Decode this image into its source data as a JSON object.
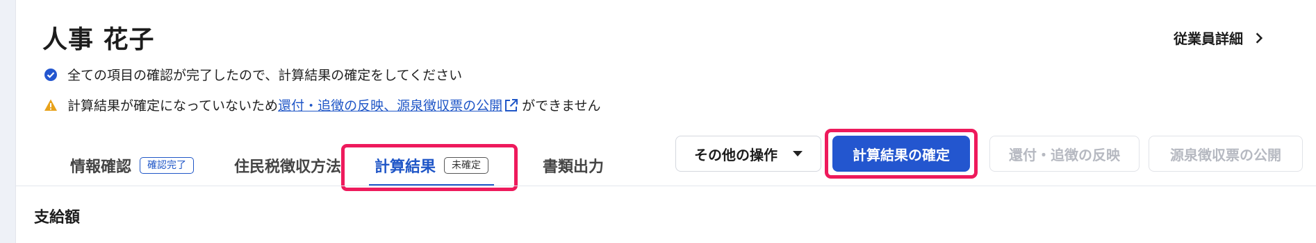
{
  "header": {
    "employee_name": "人事 花子",
    "detail_link_label": "従業員詳細"
  },
  "notices": {
    "ok_text": "全ての項目の確認が完了したので、計算結果の確定をしてください",
    "warn_prefix": "計算結果が確定になっていないため",
    "warn_link": "還付・追徴の反映、源泉徴収票の公開",
    "warn_suffix": "ができません"
  },
  "tabs": [
    {
      "label": "情報確認",
      "badge": "確認完了"
    },
    {
      "label": "住民税徴収方法",
      "badge": ""
    },
    {
      "label": "計算結果",
      "badge": "未確定"
    },
    {
      "label": "書類出力",
      "badge": ""
    }
  ],
  "actions": {
    "other_label": "その他の操作",
    "confirm_label": "計算結果の確定",
    "refund_label": "還付・追徴の反映",
    "publish_label": "源泉徴収票の公開"
  },
  "section": {
    "title": "支給額"
  },
  "colors": {
    "accent": "#2356cf",
    "highlight": "#ee1a5c",
    "warning": "#e8a21a"
  }
}
